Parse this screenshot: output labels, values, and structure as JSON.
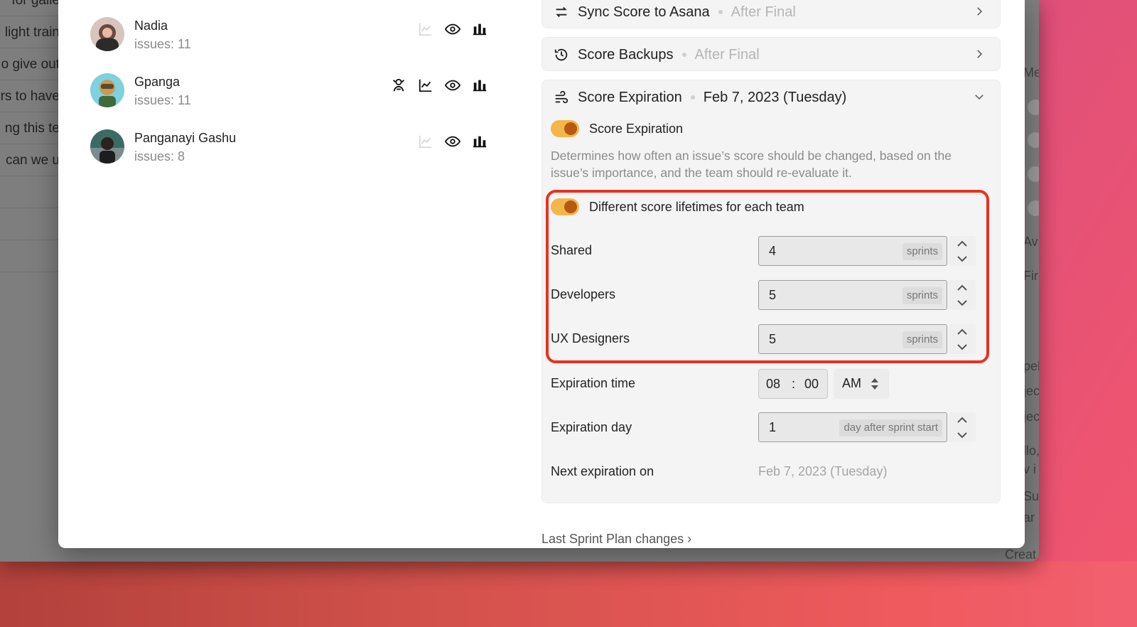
{
  "background": {
    "left_fragments": [
      "for galle",
      "light train",
      "o give out",
      "rs to have",
      "ng this te",
      "can we u"
    ],
    "right_fragments": [
      "Me",
      "Av",
      "Fir",
      "pel",
      "jec",
      "jec",
      "llo,",
      "v i",
      "Su",
      "ar",
      "Creat"
    ]
  },
  "members": [
    {
      "name": "Nadia",
      "issues": "issues: 11",
      "icons": [
        "chart-line-icon",
        "eye-icon",
        "bar-chart-icon"
      ],
      "avatar_color": "#6b4a3e",
      "chart_faded": true
    },
    {
      "name": "Gpanga",
      "issues": "issues: 11",
      "icons": [
        "hand-icon",
        "chart-line-icon",
        "eye-icon",
        "bar-chart-icon"
      ],
      "avatar_color": "#7fd0e0",
      "chart_faded": false
    },
    {
      "name": "Panganayi Gashu",
      "issues": "issues: 8",
      "icons": [
        "chart-line-icon",
        "eye-icon",
        "bar-chart-icon"
      ],
      "avatar_color": "#3b6b63",
      "chart_faded": true
    }
  ],
  "sections": {
    "sync": {
      "title": "Sync Score to Asana",
      "status": "After Final",
      "icon": "swap-arrows-icon"
    },
    "backups": {
      "title": "Score Backups",
      "status": "After Final",
      "icon": "history-icon"
    },
    "expiration": {
      "title": "Score Expiration",
      "value": "Feb 7, 2023 (Tuesday)",
      "icon": "wind-icon",
      "toggle_label": "Score Expiration",
      "description": "Determines how often an issue’s score should be changed, based on the issue’s importance, and the team should re-evaluate it.",
      "team_toggle_label": "Different score lifetimes for each team",
      "teams": [
        {
          "name": "Shared",
          "value": "4",
          "unit": "sprints"
        },
        {
          "name": "Developers",
          "value": "5",
          "unit": "sprints"
        },
        {
          "name": "UX Designers",
          "value": "5",
          "unit": "sprints"
        }
      ],
      "expiration_time_label": "Expiration time",
      "hour": "08",
      "separator": ":",
      "minute": "00",
      "ampm": "AM",
      "expiration_day_label": "Expiration day",
      "expiration_day_value": "1",
      "expiration_day_unit": "day after sprint start",
      "next_label": "Next expiration on",
      "next_value": "Feb 7, 2023 (Tuesday)"
    }
  },
  "footer_link": "Last Sprint Plan changes",
  "colors": {
    "toggle_track": "#f2b64a",
    "toggle_knob": "#b65a0f",
    "highlight": "#e8321f"
  }
}
